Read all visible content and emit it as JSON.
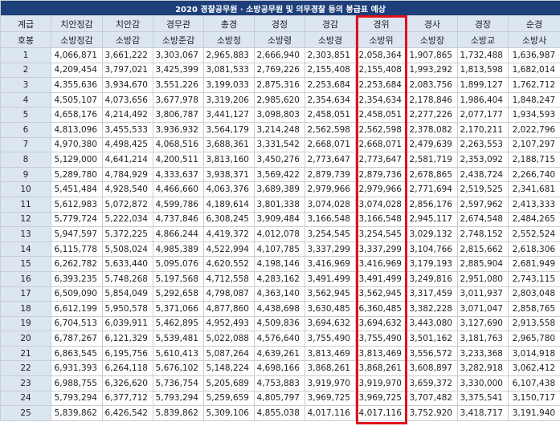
{
  "title": "2020 경찰공무원 · 소방공무원 및 의무경찰 등의 봉급표 예상",
  "header_row1": [
    "계급",
    "치안정감",
    "치안감",
    "경무관",
    "총경",
    "경정",
    "경감",
    "경위",
    "경사",
    "경장",
    "순경"
  ],
  "header_row2": [
    "호봉",
    "소방정감",
    "소방감",
    "소방준감",
    "소방정",
    "소방령",
    "소방경",
    "소방위",
    "소방장",
    "소방교",
    "소방사"
  ],
  "highlight_color": "#e0111b",
  "rows": [
    [
      "1",
      "4,066,871",
      "3,661,222",
      "3,303,067",
      "2,965,883",
      "2,666,940",
      "2,303,851",
      "2,058,364",
      "1,907,865",
      "1,732,488",
      "1,636,987"
    ],
    [
      "2",
      "4,209,454",
      "3,797,021",
      "3,425,399",
      "3,081,533",
      "2,769,226",
      "2,155,408",
      "2,155,408",
      "1,993,292",
      "1,813,598",
      "1,682,014"
    ],
    [
      "3",
      "4,355,636",
      "3,934,670",
      "3,551,226",
      "3,199,033",
      "2,875,316",
      "2,253,684",
      "2,253,684",
      "2,083,756",
      "1,899,127",
      "1,762,712"
    ],
    [
      "4",
      "4,505,107",
      "4,073,656",
      "3,677,978",
      "3,319,206",
      "2,985,620",
      "2,354,634",
      "2,354,634",
      "2,178,846",
      "1,986,404",
      "1,848,247"
    ],
    [
      "5",
      "4,658,176",
      "4,214,492",
      "3,806,787",
      "3,441,127",
      "3,098,803",
      "2,458,051",
      "2,458,051",
      "2,277,226",
      "2,077,177",
      "1,934,593"
    ],
    [
      "6",
      "4,813,096",
      "3,455,533",
      "3,936,932",
      "3,564,179",
      "3,214,248",
      "2,562,598",
      "2,562,598",
      "2,378,082",
      "2,170,211",
      "2,022,796"
    ],
    [
      "7",
      "4,970,380",
      "4,498,425",
      "4,068,516",
      "3,688,361",
      "3,331,542",
      "2,668,071",
      "2,668,071",
      "2,479,639",
      "2,263,553",
      "2,107,297"
    ],
    [
      "8",
      "5,129,000",
      "4,641,214",
      "4,200,511",
      "3,813,160",
      "3,450,276",
      "2,773,647",
      "2,773,647",
      "2,581,719",
      "2,353,092",
      "2,188,715"
    ],
    [
      "9",
      "5,289,780",
      "4,784,929",
      "4,333,637",
      "3,938,371",
      "3,569,422",
      "2,879,739",
      "2,879,736",
      "2,678,865",
      "2,438,724",
      "2,266,740"
    ],
    [
      "10",
      "5,451,484",
      "4,928,540",
      "4,466,660",
      "4,063,376",
      "3,689,389",
      "2,979,966",
      "2,979,966",
      "2,771,694",
      "2,519,525",
      "2,341,681"
    ],
    [
      "11",
      "5,612,983",
      "5,072,872",
      "4,599,786",
      "4,189,614",
      "3,801,338",
      "3,074,028",
      "3,074,028",
      "2,856,176",
      "2,597,962",
      "2,413,333"
    ],
    [
      "12",
      "5,779,724",
      "5,222,034",
      "4,737,846",
      "6,308,245",
      "3,909,484",
      "3,166,548",
      "3,166,548",
      "2,945,117",
      "2,674,548",
      "2,484,265"
    ],
    [
      "13",
      "5,947,597",
      "5,372,225",
      "4,866,244",
      "4,419,372",
      "4,012,078",
      "3,254,545",
      "3,254,545",
      "3,029,132",
      "2,748,152",
      "2,552,524"
    ],
    [
      "14",
      "6,115,778",
      "5,508,024",
      "4,985,389",
      "4,522,994",
      "4,107,785",
      "3,337,299",
      "3,337,299",
      "3,104,766",
      "2,815,662",
      "2,618,306"
    ],
    [
      "15",
      "6,262,782",
      "5,633,440",
      "5,095,076",
      "4,620,552",
      "4,198,146",
      "3,416,969",
      "3,416,969",
      "3,179,193",
      "2,885,904",
      "2,681,949"
    ],
    [
      "16",
      "6,393,235",
      "5,748,268",
      "5,197,568",
      "4,712,558",
      "4,283,162",
      "3,491,499",
      "3,491,499",
      "3,249,816",
      "2,951,080",
      "2,743,115"
    ],
    [
      "17",
      "6,509,090",
      "5,854,049",
      "5,292,658",
      "4,798,087",
      "4,363,140",
      "3,562,945",
      "3,562,945",
      "3,317,459",
      "3,011,937",
      "2,803,048"
    ],
    [
      "18",
      "6,612,199",
      "5,950,578",
      "5,371,066",
      "4,877,860",
      "4,438,698",
      "3,630,485",
      "6,360,485",
      "3,382,228",
      "3,071,047",
      "2,858,765"
    ],
    [
      "19",
      "6,704,513",
      "6,039,911",
      "5,462,895",
      "4,952,493",
      "4,509,836",
      "3,694,632",
      "3,694,632",
      "3,443,080",
      "3,127,690",
      "2,913,558"
    ],
    [
      "20",
      "6,787,267",
      "6,121,329",
      "5,539,481",
      "5,022,088",
      "4,576,640",
      "3,755,490",
      "3,755,490",
      "3,501,162",
      "3,181,763",
      "2,965,780"
    ],
    [
      "21",
      "6,863,545",
      "6,195,756",
      "5,610,413",
      "5,087,264",
      "4,639,261",
      "3,813,469",
      "3,813,469",
      "3,556,572",
      "3,233,368",
      "3,014,918"
    ],
    [
      "22",
      "6,931,393",
      "6,264,118",
      "5,676,102",
      "5,148,224",
      "4,698,166",
      "3,868,261",
      "3,868,261",
      "3,608,897",
      "3,282,918",
      "3,062,412"
    ],
    [
      "23",
      "6,988,755",
      "6,326,620",
      "5,736,754",
      "5,205,689",
      "4,753,883",
      "3,919,970",
      "3,919,970",
      "3,659,372",
      "3,330,000",
      "6,107,438"
    ],
    [
      "24",
      "5,793,294",
      "6,377,712",
      "5,793,294",
      "5,259,659",
      "4,805,797",
      "3,969,725",
      "3,969,725",
      "3,707,482",
      "3,375,541",
      "3,150,717"
    ],
    [
      "25",
      "5,839,862",
      "6,426,542",
      "5,839,862",
      "5,309,106",
      "4,855,038",
      "4,017,116",
      "4,017,116",
      "3,752,920",
      "3,418,717",
      "3,191,940"
    ]
  ]
}
